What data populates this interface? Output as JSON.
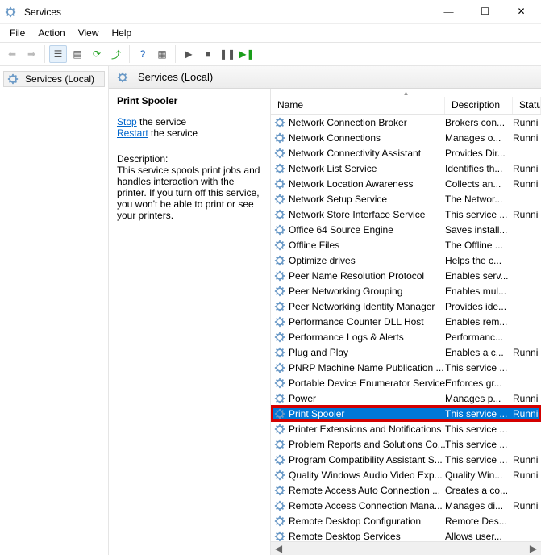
{
  "titlebar": {
    "title": "Services"
  },
  "menu": {
    "file": "File",
    "action": "Action",
    "view": "View",
    "help": "Help"
  },
  "tree": {
    "root": "Services (Local)"
  },
  "right_header": "Services (Local)",
  "detail": {
    "selected_name": "Print Spooler",
    "stop_link": "Stop",
    "stop_tail": " the service",
    "restart_link": "Restart",
    "restart_tail": " the service",
    "desc_head": "Description:",
    "desc_body": "This service spools print jobs and handles interaction with the printer. If you turn off this service, you won't be able to print or see your printers."
  },
  "columns": {
    "name": "Name",
    "description": "Description",
    "status": "Status"
  },
  "services": [
    {
      "name": "Network Connection Broker",
      "desc": "Brokers con...",
      "status": "Runni"
    },
    {
      "name": "Network Connections",
      "desc": "Manages o...",
      "status": "Runni"
    },
    {
      "name": "Network Connectivity Assistant",
      "desc": "Provides Dir...",
      "status": ""
    },
    {
      "name": "Network List Service",
      "desc": "Identifies th...",
      "status": "Runni"
    },
    {
      "name": "Network Location Awareness",
      "desc": "Collects an...",
      "status": "Runni"
    },
    {
      "name": "Network Setup Service",
      "desc": "The Networ...",
      "status": ""
    },
    {
      "name": "Network Store Interface Service",
      "desc": "This service ...",
      "status": "Runni"
    },
    {
      "name": "Office 64 Source Engine",
      "desc": "Saves install...",
      "status": ""
    },
    {
      "name": "Offline Files",
      "desc": "The Offline ...",
      "status": ""
    },
    {
      "name": "Optimize drives",
      "desc": "Helps the c...",
      "status": ""
    },
    {
      "name": "Peer Name Resolution Protocol",
      "desc": "Enables serv...",
      "status": ""
    },
    {
      "name": "Peer Networking Grouping",
      "desc": "Enables mul...",
      "status": ""
    },
    {
      "name": "Peer Networking Identity Manager",
      "desc": "Provides ide...",
      "status": ""
    },
    {
      "name": "Performance Counter DLL Host",
      "desc": "Enables rem...",
      "status": ""
    },
    {
      "name": "Performance Logs & Alerts",
      "desc": "Performanc...",
      "status": ""
    },
    {
      "name": "Plug and Play",
      "desc": "Enables a c...",
      "status": "Runni"
    },
    {
      "name": "PNRP Machine Name Publication ...",
      "desc": "This service ...",
      "status": ""
    },
    {
      "name": "Portable Device Enumerator Service",
      "desc": "Enforces gr...",
      "status": ""
    },
    {
      "name": "Power",
      "desc": "Manages p...",
      "status": "Runni"
    },
    {
      "name": "Print Spooler",
      "desc": "This service ...",
      "status": "Runni",
      "selected": true
    },
    {
      "name": "Printer Extensions and Notifications",
      "desc": "This service ...",
      "status": ""
    },
    {
      "name": "Problem Reports and Solutions Co...",
      "desc": "This service ...",
      "status": ""
    },
    {
      "name": "Program Compatibility Assistant S...",
      "desc": "This service ...",
      "status": "Runni"
    },
    {
      "name": "Quality Windows Audio Video Exp...",
      "desc": "Quality Win...",
      "status": "Runni"
    },
    {
      "name": "Remote Access Auto Connection ...",
      "desc": "Creates a co...",
      "status": ""
    },
    {
      "name": "Remote Access Connection Mana...",
      "desc": "Manages di...",
      "status": "Runni"
    },
    {
      "name": "Remote Desktop Configuration",
      "desc": "Remote Des...",
      "status": ""
    },
    {
      "name": "Remote Desktop Services",
      "desc": "Allows user...",
      "status": ""
    }
  ]
}
